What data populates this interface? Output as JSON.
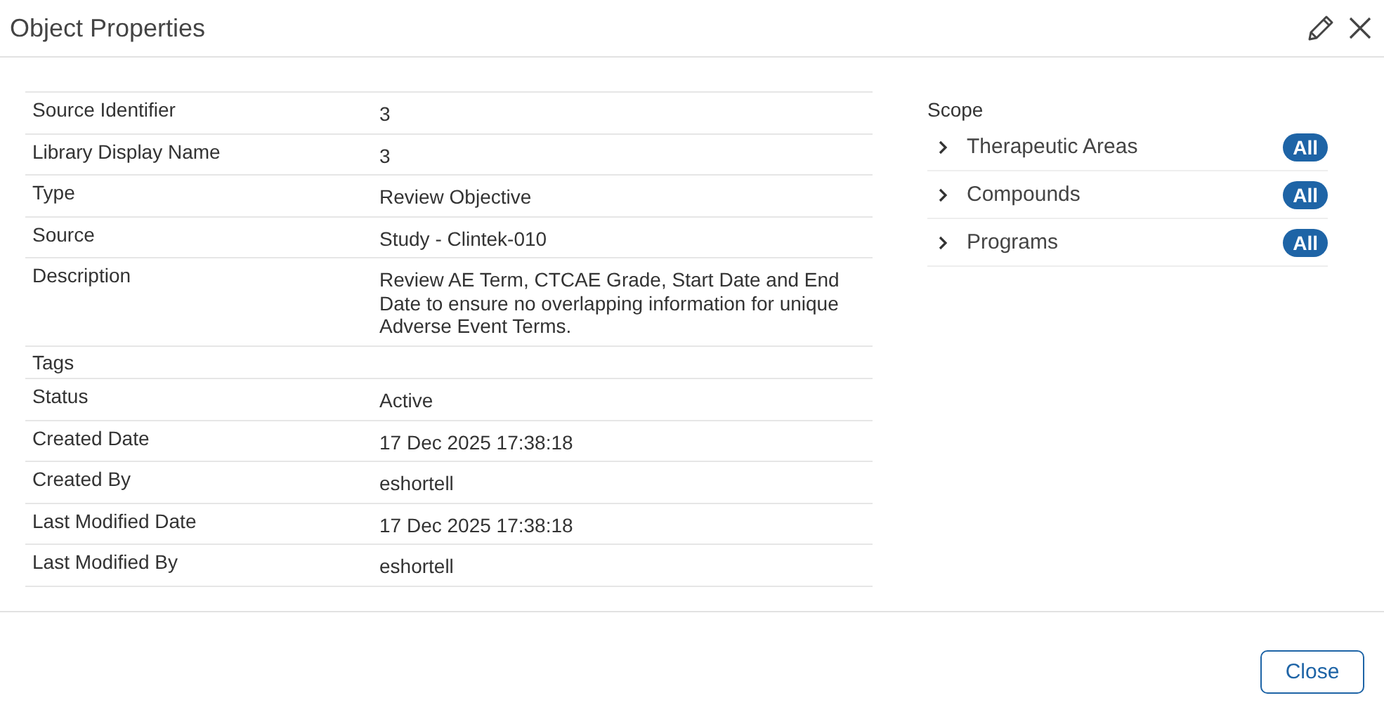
{
  "window": {
    "title": "Object Properties"
  },
  "properties": [
    {
      "label": "Source Identifier",
      "value": "3"
    },
    {
      "label": "Library Display Name",
      "value": "3"
    },
    {
      "label": "Type",
      "value": "Review Objective"
    },
    {
      "label": "Source",
      "value": "Study - Clintek-010"
    },
    {
      "label": "Description",
      "value": "Review AE Term, CTCAE Grade, Start Date and End Date to ensure no overlapping information for unique Adverse Event Terms."
    },
    {
      "label": "Tags"
    },
    {
      "label": "Status",
      "value": "Active"
    },
    {
      "label": "Created Date",
      "value": "17 Dec 2025 17:38:18"
    },
    {
      "label": "Created By",
      "value": "eshortell"
    },
    {
      "label": "Last Modified Date",
      "value": "17 Dec 2025 17:38:18"
    },
    {
      "label": "Last Modified By",
      "value": "eshortell"
    }
  ],
  "scope": {
    "title": "Scope",
    "items": [
      {
        "label": "Therapeutic Areas",
        "badge": "All",
        "expanded": false
      },
      {
        "label": "Compounds",
        "badge": "All",
        "expanded": false
      },
      {
        "label": "Programs",
        "badge": "All",
        "expanded": false
      }
    ]
  },
  "buttons": [
    "Close"
  ]
}
